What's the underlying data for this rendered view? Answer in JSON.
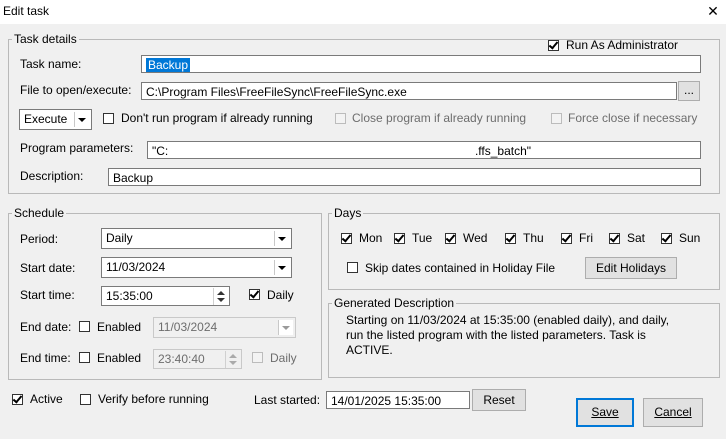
{
  "window": {
    "title": "Edit task",
    "close_glyph": "✕"
  },
  "task_details": {
    "legend": "Task details",
    "run_as_admin": {
      "label": "Run As Administrator",
      "checked": true
    },
    "task_name_label": "Task name:",
    "task_name_value": "Backup",
    "file_label": "File to open/execute:",
    "file_value": "C:\\Program Files\\FreeFileSync\\FreeFileSync.exe",
    "browse_label": "...",
    "action_select": "Execute",
    "dont_run": {
      "label": "Don't run program if already running",
      "checked": false
    },
    "close_program": {
      "label": "Close program if already running",
      "checked": false
    },
    "force_close": {
      "label": "Force close if necessary",
      "checked": false
    },
    "params_label": "Program parameters:",
    "params_value_start": "\"C:",
    "params_value_end": ".ffs_batch\"",
    "description_label": "Description:",
    "description_value": "Backup"
  },
  "schedule": {
    "legend": "Schedule",
    "period_label": "Period:",
    "period_value": "Daily",
    "start_date_label": "Start date:",
    "start_date_value": "11/03/2024",
    "start_time_label": "Start time:",
    "start_time_value": "15:35:00",
    "start_daily": {
      "label": "Daily",
      "checked": true
    },
    "end_date_label": "End date:",
    "end_date_enabled": {
      "label": "Enabled",
      "checked": false
    },
    "end_date_value": "11/03/2024",
    "end_time_label": "End time:",
    "end_time_enabled": {
      "label": "Enabled",
      "checked": false
    },
    "end_time_value": "23:40:40",
    "end_daily": {
      "label": "Daily",
      "checked": false
    }
  },
  "days": {
    "legend": "Days",
    "items": [
      {
        "label": "Mon",
        "checked": true
      },
      {
        "label": "Tue",
        "checked": true
      },
      {
        "label": "Wed",
        "checked": true
      },
      {
        "label": "Thu",
        "checked": true
      },
      {
        "label": "Fri",
        "checked": true
      },
      {
        "label": "Sat",
        "checked": true
      },
      {
        "label": "Sun",
        "checked": true
      }
    ],
    "skip_holidays": {
      "label": "Skip dates contained in Holiday File",
      "checked": false
    },
    "edit_holidays_label": "Edit Holidays"
  },
  "generated": {
    "legend": "Generated Description",
    "line1": "Starting on 11/03/2024 at 15:35:00 (enabled daily), and daily,",
    "line2": "run the listed program with the listed parameters. Task is",
    "line3": "ACTIVE."
  },
  "footer": {
    "active": {
      "label": "Active",
      "checked": true
    },
    "verify": {
      "label": "Verify before running",
      "checked": false
    },
    "last_started_label": "Last started:",
    "last_started_value": "14/01/2025 15:35:00",
    "reset_label": "Reset",
    "save_label": "Save",
    "cancel_label": "Cancel"
  },
  "colors": {
    "accent": "#0078d7",
    "window_bg": "#f0f0f0"
  }
}
